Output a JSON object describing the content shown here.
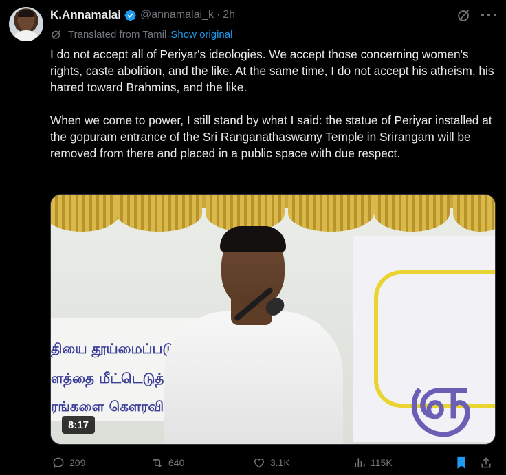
{
  "author": {
    "name": "K.Annamalai",
    "handle": "@annamalai_k",
    "separator": "·",
    "time": "2h"
  },
  "translation": {
    "label": "Translated from Tamil",
    "show_original": "Show original"
  },
  "body": {
    "paragraph1": "I do not accept all of Periyar's ideologies. We accept those concerning women's rights, caste abolition, and the like. At the same time, I do not accept his atheism, his hatred toward Brahmins, and the like.",
    "paragraph2": "When we come to power, I still stand by what I said: the statue of Periyar installed at the gopuram entrance of the Sri Ranganathaswamy Temple in Srirangam will be removed from there and placed in a public space with due respect."
  },
  "video": {
    "duration": "8:17",
    "banner_lines": [
      "தியை தூய்மைப்படுத்த",
      "ளத்தை மீட்டெடுத்த",
      "ரங்களை கௌரவி"
    ],
    "banner_letter": "ஞ"
  },
  "actions": {
    "replies": "209",
    "retweets": "640",
    "likes": "3.1K",
    "views": "115K"
  },
  "colors": {
    "background": "#000000",
    "text": "#e7e9ea",
    "muted": "#71767b",
    "accent": "#1d9bf0"
  }
}
